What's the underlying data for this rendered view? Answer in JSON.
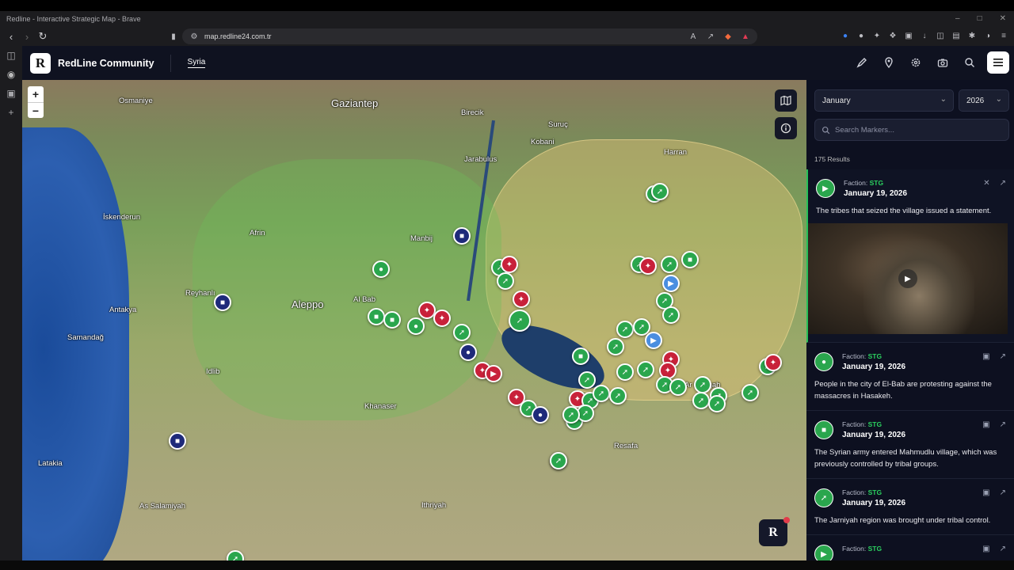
{
  "browser": {
    "window_title": "Redline - Interactive Strategic Map - Brave",
    "url": "map.redline24.com.tr"
  },
  "header": {
    "brand": "RedLine Community",
    "logo_letter": "R",
    "region_tab": "Syria"
  },
  "map": {
    "zoom_in": "+",
    "zoom_out": "−",
    "badge_letter": "R",
    "cities": [
      {
        "name": "Gaziantep",
        "big": true
      },
      {
        "name": "Osmaniye"
      },
      {
        "name": "Aleppo",
        "big": true
      },
      {
        "name": "İskenderun"
      },
      {
        "name": "Antakya"
      },
      {
        "name": "Latakia"
      },
      {
        "name": "Afrin"
      },
      {
        "name": "Idlib"
      },
      {
        "name": "Jarabulus"
      },
      {
        "name": "Kobani"
      },
      {
        "name": "Suruç"
      },
      {
        "name": "Birecik"
      },
      {
        "name": "Harran"
      },
      {
        "name": "Reyhanlı"
      },
      {
        "name": "Samandağ"
      },
      {
        "name": "Manbij"
      },
      {
        "name": "Al Bab"
      },
      {
        "name": "Resafa"
      },
      {
        "name": "As Salamiyah"
      },
      {
        "name": "Khanaser"
      },
      {
        "name": "Ithriyah"
      },
      {
        "name": "Ar Raqqah"
      }
    ]
  },
  "panel": {
    "month": "January",
    "year": "2026",
    "search_placeholder": "Search Markers...",
    "results": "175 Results",
    "faction_label": "Faction:",
    "items": [
      {
        "faction": "STG",
        "date": "January 19, 2026",
        "text": "The tribes that seized the village issued a statement.",
        "icon": "megaphone-icon",
        "has_video": true
      },
      {
        "faction": "STG",
        "date": "January 19, 2026",
        "text": "People in the city of El-Bab are protesting against the massacres in Hasakeh.",
        "icon": "people-icon",
        "has_video": false
      },
      {
        "faction": "STG",
        "date": "January 19, 2026",
        "text": "The Syrian army entered Mahmudlu village, which was previously controlled by tribal groups.",
        "icon": "truck-icon",
        "has_video": false
      },
      {
        "faction": "STG",
        "date": "January 19, 2026",
        "text": "The Jarniyah region was brought under tribal control.",
        "icon": "rifle-icon",
        "has_video": false
      },
      {
        "faction": "STG",
        "date": "",
        "text": "",
        "icon": "megaphone-icon",
        "has_video": false
      }
    ]
  },
  "colors": {
    "stg_green": "#2aa64d",
    "hostile_red": "#c8213a",
    "navy": "#1e2a7a",
    "blue": "#4a8ee0"
  }
}
